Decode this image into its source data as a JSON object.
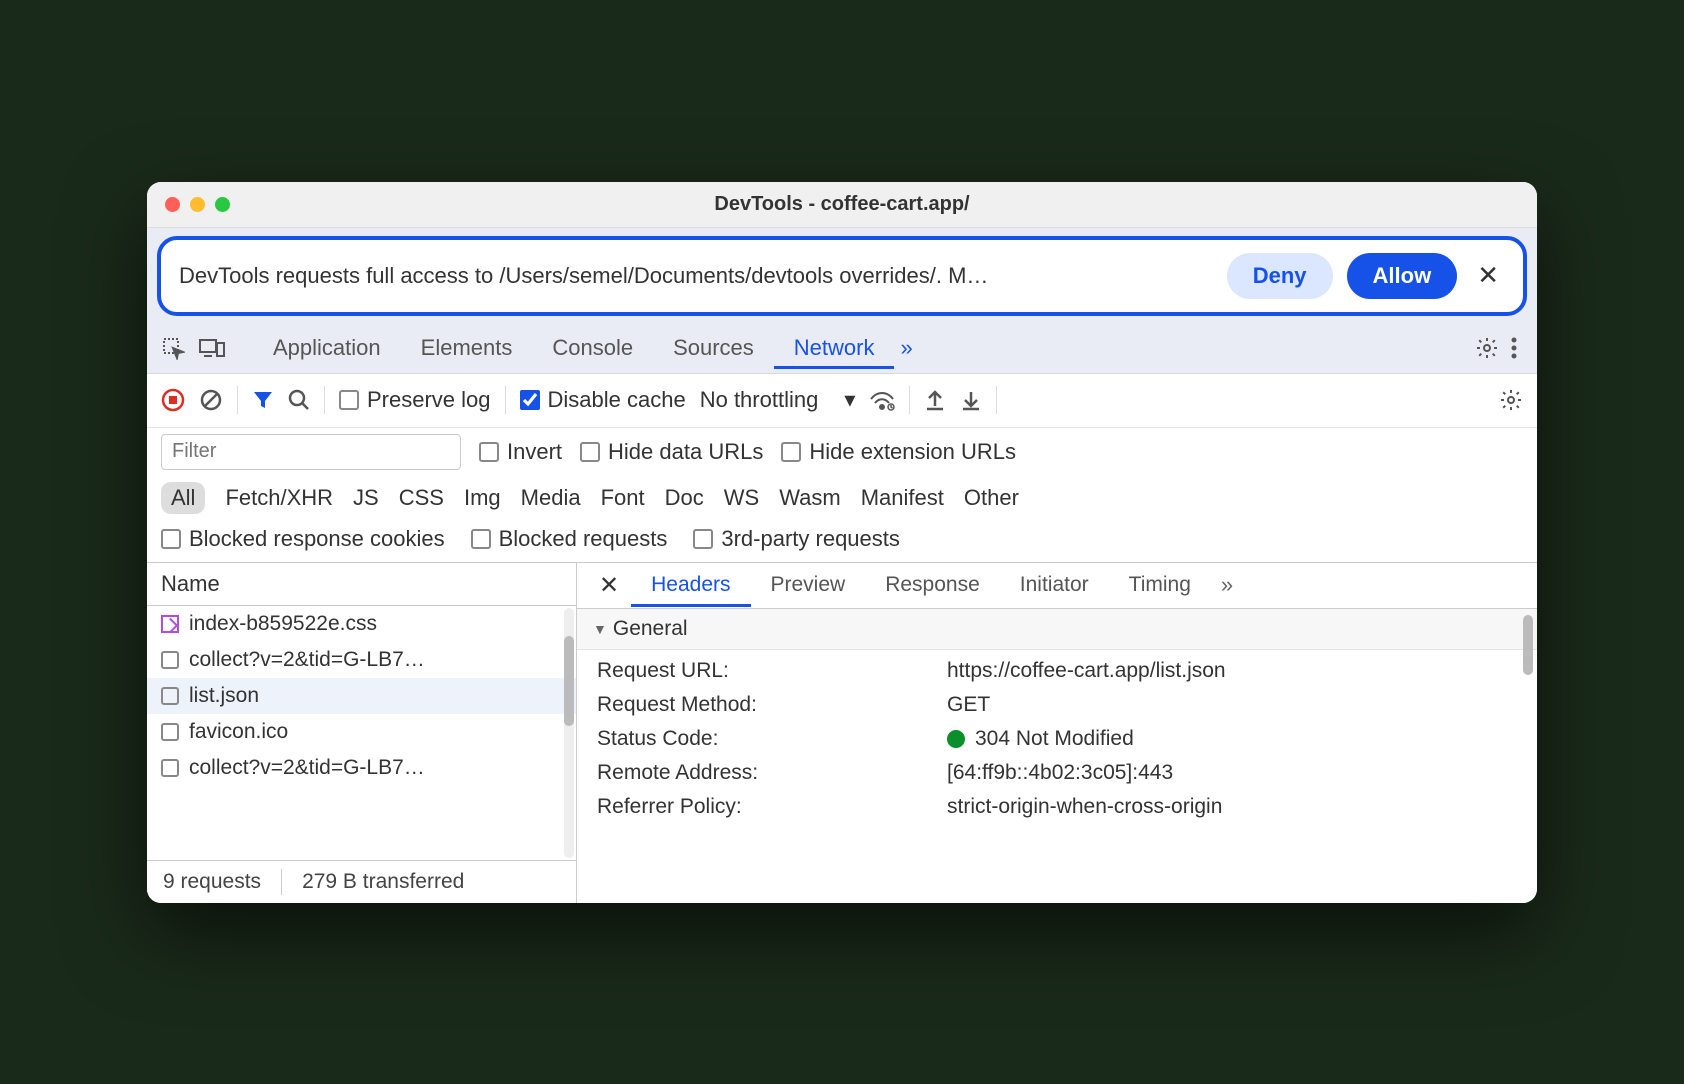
{
  "window": {
    "title": "DevTools - coffee-cart.app/"
  },
  "permission": {
    "message": "DevTools requests full access to /Users/semel/Documents/devtools overrides/. M…",
    "deny": "Deny",
    "allow": "Allow"
  },
  "panels": {
    "application": "Application",
    "elements": "Elements",
    "console": "Console",
    "sources": "Sources",
    "network": "Network"
  },
  "net_toolbar": {
    "preserve": "Preserve log",
    "disable_cache": "Disable cache",
    "throttling": "No throttling"
  },
  "filters": {
    "placeholder": "Filter",
    "invert": "Invert",
    "hide_data": "Hide data URLs",
    "hide_ext": "Hide extension URLs"
  },
  "types": {
    "all": "All",
    "fetch": "Fetch/XHR",
    "js": "JS",
    "css": "CSS",
    "img": "Img",
    "media": "Media",
    "font": "Font",
    "doc": "Doc",
    "ws": "WS",
    "wasm": "Wasm",
    "manifest": "Manifest",
    "other": "Other"
  },
  "more_filters": {
    "blocked_cookies": "Blocked response cookies",
    "blocked_req": "Blocked requests",
    "third_party": "3rd-party requests"
  },
  "reqlist": {
    "col_name": "Name",
    "rows": [
      "index-b859522e.css",
      "collect?v=2&tid=G-LB7…",
      "list.json",
      "favicon.ico",
      "collect?v=2&tid=G-LB7…"
    ]
  },
  "detail": {
    "tabs": {
      "headers": "Headers",
      "preview": "Preview",
      "response": "Response",
      "initiator": "Initiator",
      "timing": "Timing"
    },
    "general_label": "General",
    "general": {
      "request_url_k": "Request URL:",
      "request_url_v": "https://coffee-cart.app/list.json",
      "request_method_k": "Request Method:",
      "request_method_v": "GET",
      "status_k": "Status Code:",
      "status_v": "304 Not Modified",
      "remote_k": "Remote Address:",
      "remote_v": "[64:ff9b::4b02:3c05]:443",
      "referrer_k": "Referrer Policy:",
      "referrer_v": "strict-origin-when-cross-origin"
    }
  },
  "footer": {
    "requests": "9 requests",
    "transferred": "279 B transferred"
  }
}
